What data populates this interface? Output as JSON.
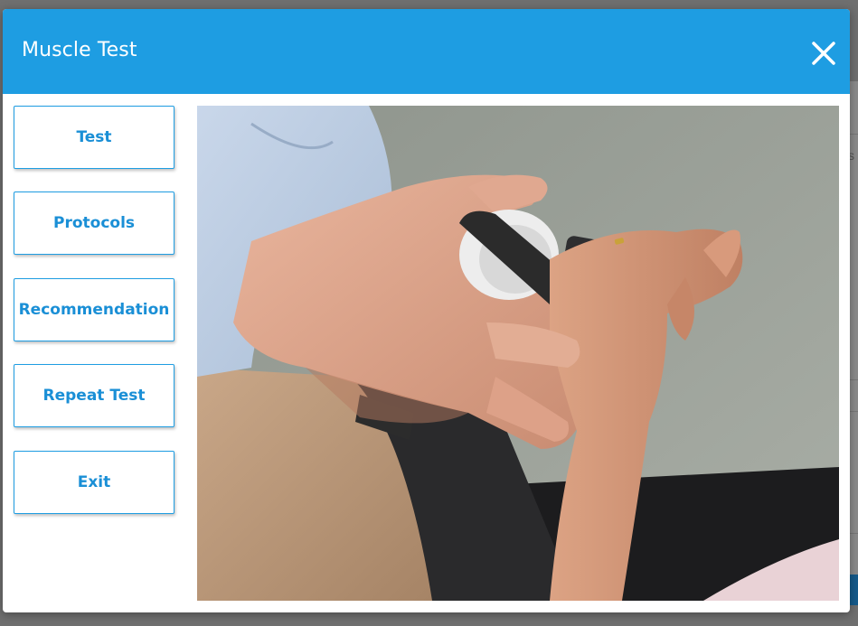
{
  "dialog": {
    "title": "Muscle Test"
  },
  "menu": {
    "items": [
      {
        "label": "Test"
      },
      {
        "label": "Protocols"
      },
      {
        "label": "Recommendation"
      },
      {
        "label": "Repeat Test"
      },
      {
        "label": "Exit"
      }
    ]
  },
  "icons": {
    "close": "close-icon"
  },
  "colors": {
    "header": "#1e9de2",
    "button_text": "#1a8fd6",
    "button_border": "#1e9de2"
  },
  "background": {
    "partial_text": "s"
  }
}
